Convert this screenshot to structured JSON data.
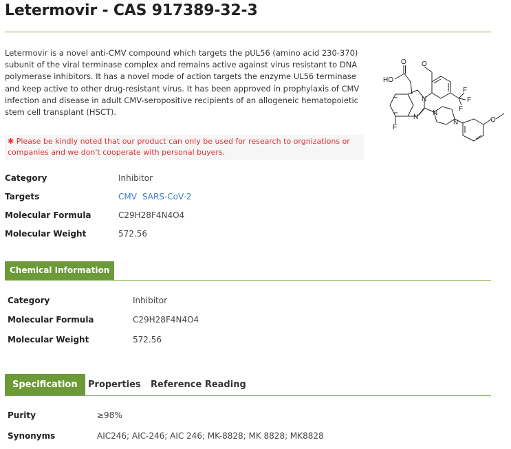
{
  "title": "Letermovir - CAS 917389-32-3",
  "description": "Letermovir is a novel anti-CMV compound which targets the pUL56 (amino acid 230-370) subunit of the viral terminase complex and remains active against virus resistant to DNA polymerase inhibitors. It has a novel mode of action targets the enzyme UL56 terminase and keep active to other drug-resistant virus. It has been approved in prophylaxis of CMV infection and disease in adult CMV-seropositive recipients of an allogeneic hematopoietic stem cell transplant (HSCT).",
  "notice": {
    "star": "✱",
    "text": " Please be kindly noted that our product can only be used for research to orgnizations or companies and we don't cooperate with personal buyers."
  },
  "summary": {
    "category_label": "Category",
    "category_value": "Inhibitor",
    "targets_label": "Targets",
    "targets": [
      "CMV",
      "SARS-CoV-2"
    ],
    "formula_label": "Molecular Formula",
    "formula_value": "C29H28F4N4O4",
    "weight_label": "Molecular Weight",
    "weight_value": "572.56"
  },
  "chemical_information": {
    "tab_label": "Chemical Information",
    "category_label": "Category",
    "category_value": "Inhibitor",
    "formula_label": "Molecular Formula",
    "formula_value": "C29H28F4N4O4",
    "weight_label": "Molecular Weight",
    "weight_value": "572.56"
  },
  "spec_tabs": {
    "specification": "Specification",
    "properties": "Properties",
    "reference": "Reference Reading"
  },
  "specification": {
    "purity_label": "Purity",
    "purity_value": "≥98%",
    "synonyms_label": "Synonyms",
    "synonyms_value": "AIC246; AIC-246; AIC 246; MK-8828; MK 8828; MK8828"
  },
  "structure_labels": {
    "o1": "O",
    "ho": "HO",
    "o2": "O",
    "n1": "N",
    "n2": "N",
    "n3": "N",
    "n4": "N",
    "f1": "F",
    "f2": "F",
    "f3": "F",
    "f4": "F",
    "o3": "O"
  },
  "colors": {
    "accent": "#6b9a36",
    "rule": "#7cab3d",
    "notice": "#e02d2d",
    "link": "#3a7dc4"
  }
}
